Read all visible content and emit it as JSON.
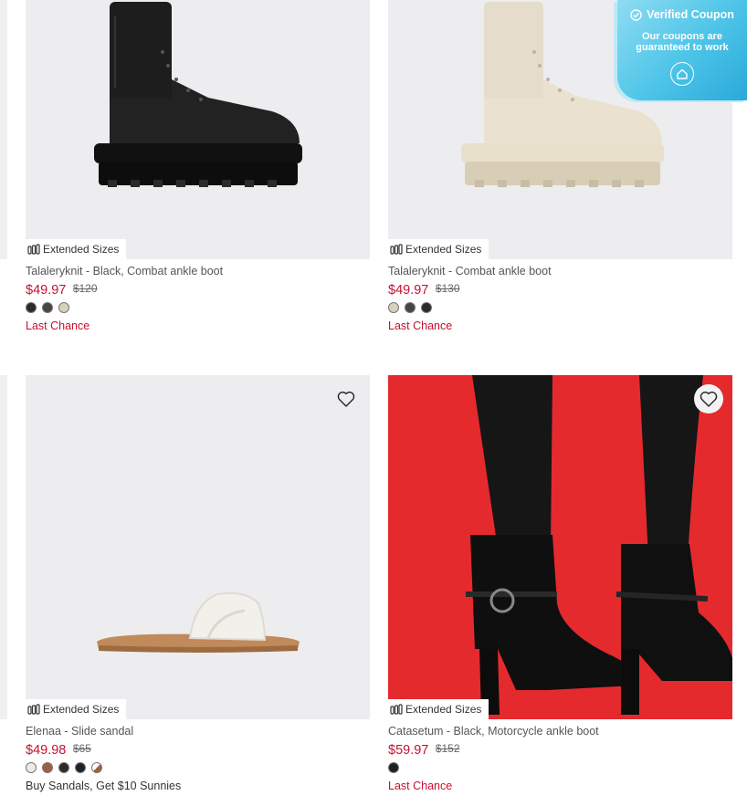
{
  "coupon": {
    "title": "Verified Coupon",
    "line1": "Our coupons are",
    "line2": "guaranteed to work",
    "icons": {
      "check": "check-circle-icon",
      "action": "coupon-action-icon"
    }
  },
  "products": [
    {
      "badge": "Extended Sizes",
      "name": "Talaleryknit - Black, Combat ankle boot",
      "price": "$49.97",
      "original_price": "$120",
      "colors": [
        "#2b2b2b",
        "#4a4542",
        "#d8d1c0"
      ],
      "promo": "Last Chance",
      "wishlist_icon": "heart-icon"
    },
    {
      "badge": "Extended Sizes",
      "name": "Talaleryknit - Combat ankle boot",
      "price": "$49.97",
      "original_price": "$130",
      "colors": [
        "#d8d1c0",
        "#4a4542",
        "#2b2b2b"
      ],
      "promo": "Last Chance",
      "wishlist_icon": "heart-icon"
    },
    {
      "badge": "Extended Sizes",
      "name": "Elenaa - Slide sandal",
      "price": "$49.98",
      "original_price": "$65",
      "colors": [
        "#ecebe6",
        "#a35e3e",
        "#2b2b2b",
        "#1e2230",
        "#c9a79a"
      ],
      "promo": "Buy Sandals, Get $10 Sunnies",
      "wishlist_icon": "heart-icon"
    },
    {
      "badge": "Extended Sizes",
      "name": "Catasetum - Black, Motorcycle ankle boot",
      "price": "$59.97",
      "original_price": "$152",
      "colors": [
        "#1f1f1f"
      ],
      "promo": "Last Chance",
      "wishlist_icon": "heart-icon"
    }
  ]
}
